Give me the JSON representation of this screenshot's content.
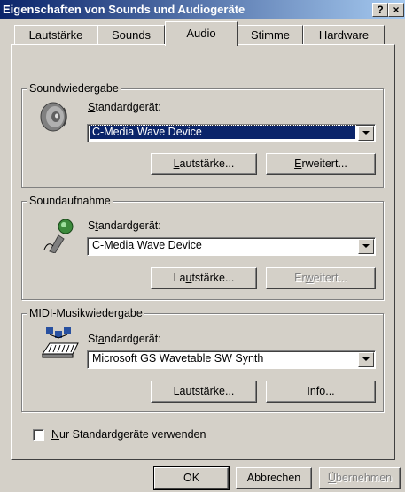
{
  "window": {
    "title": "Eigenschaften von Sounds und Audiogeräte",
    "help_button": "?",
    "close_button": "×"
  },
  "tabs": [
    {
      "label": "Lautstärke"
    },
    {
      "label": "Sounds"
    },
    {
      "label": "Audio"
    },
    {
      "label": "Stimme"
    },
    {
      "label": "Hardware"
    }
  ],
  "playback": {
    "group_label": "Soundwiedergabe",
    "device_label": "Standardgerät:",
    "device_value": "C-Media Wave Device",
    "volume_button": "Lautstärke...",
    "advanced_button": "Erweitert..."
  },
  "recording": {
    "group_label": "Soundaufnahme",
    "device_label": "Standardgerät:",
    "device_value": "C-Media Wave Device",
    "volume_button": "Lautstärke...",
    "advanced_button": "Erweitert..."
  },
  "midi": {
    "group_label": "MIDI-Musikwiedergabe",
    "device_label": "Standardgerät:",
    "device_value": "Microsoft GS Wavetable SW Synth",
    "volume_button": "Lautstärke...",
    "info_button": "Info..."
  },
  "checkbox": {
    "label": "Nur Standardgeräte verwenden",
    "checked": false
  },
  "footer": {
    "ok": "OK",
    "cancel": "Abbrechen",
    "apply": "Übernehmen"
  }
}
